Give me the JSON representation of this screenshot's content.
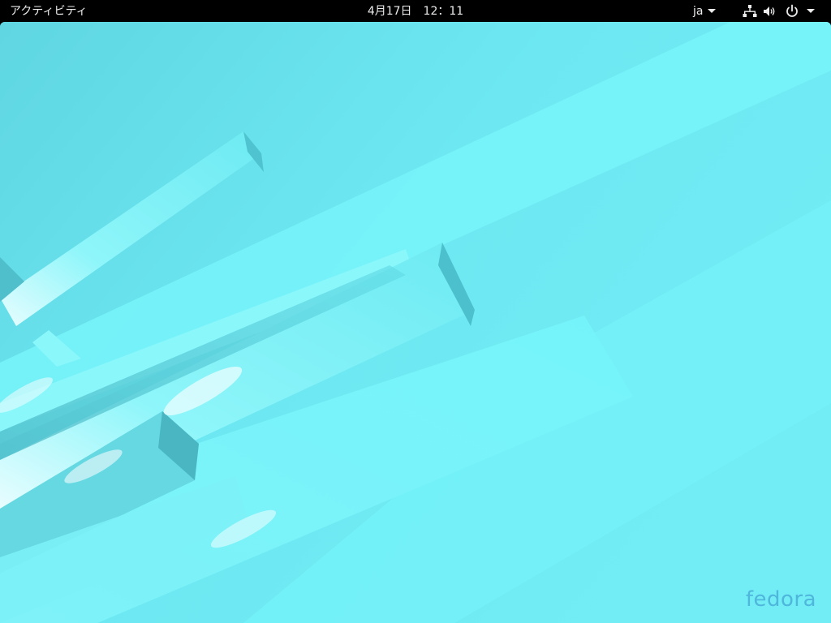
{
  "topbar": {
    "activities_label": "アクティビティ",
    "clock": "4月17日　12：11",
    "input_method": "ja"
  },
  "icons": {
    "network": "network-wired-icon",
    "volume": "speaker-volume-icon",
    "power": "power-icon",
    "menu_arrow": "chevron-down-icon"
  },
  "desktop": {
    "logo_text": "fedora",
    "colors": {
      "wallpaper_base": "#6ee8f0",
      "bar_highlight": "#9ffafe",
      "logo": "#4fb6dc",
      "topbar": "#000000"
    }
  }
}
